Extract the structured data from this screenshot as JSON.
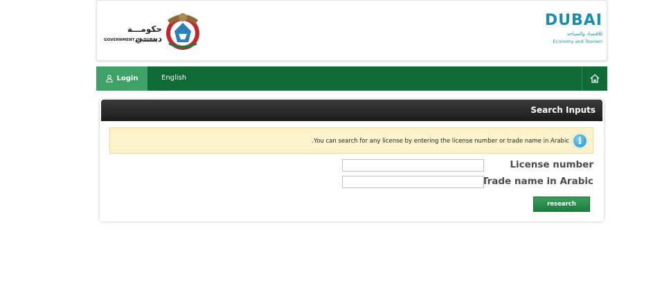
{
  "header": {
    "gov_arabic": "حكومـــة دبــــي",
    "gov_english": "GOVERNMENT OF DUBAI",
    "det_wordmark": "DUBAI",
    "det_arabic": "للاقتصاد والسياحة",
    "det_english": "Economy and Tourism"
  },
  "nav": {
    "login_label": "Login",
    "language_label": "English",
    "icons": {
      "login": "user-icon",
      "home": "home-icon"
    }
  },
  "panel": {
    "title": "Search Inputs",
    "info_text": "You can search for any license by entering the license number or trade name in Arabic.",
    "info_icon": "info-icon",
    "fields": [
      {
        "label": "License number",
        "value": ""
      },
      {
        "label": "Trade name in Arabic",
        "value": ""
      }
    ],
    "search_label": "research"
  },
  "colors": {
    "nav_green": "#0f6a35",
    "login_green": "#3ea267",
    "brand_teal": "#1a8ea8",
    "info_bg": "#fcf3cd"
  }
}
